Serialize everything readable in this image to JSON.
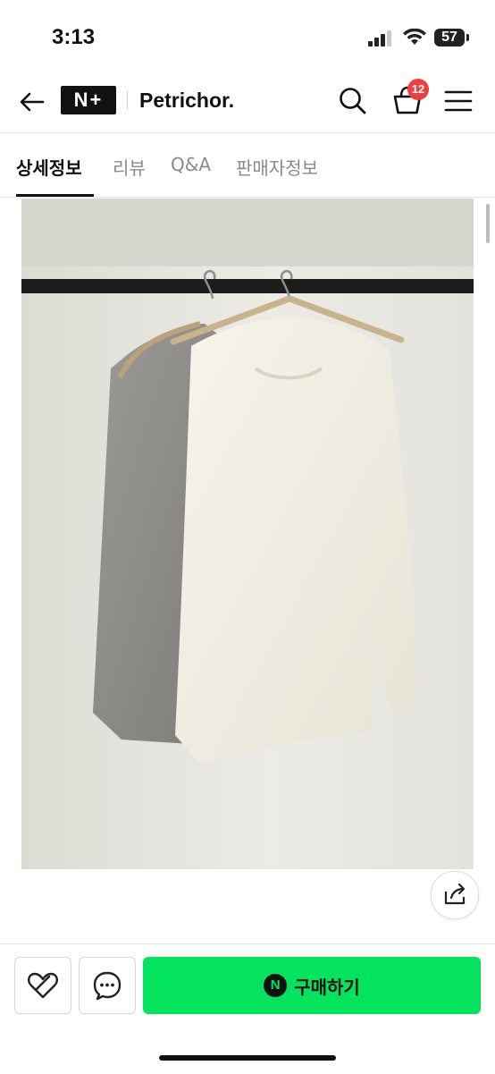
{
  "status_bar": {
    "time": "3:13",
    "battery": "57"
  },
  "header": {
    "logo": "N+",
    "store_name": "Petrichor.",
    "cart_count": "12"
  },
  "tabs": [
    {
      "label": "상세정보",
      "active": true
    },
    {
      "label": "리뷰",
      "active": false
    },
    {
      "label": "Q&A",
      "active": false
    },
    {
      "label": "판매자정보",
      "active": false
    }
  ],
  "bottom_bar": {
    "buy_label": "구매하기",
    "buy_icon_letter": "N"
  },
  "colors": {
    "buy_button": "#03e35d",
    "badge": "#f0403e",
    "active_tab": "#111111",
    "inactive_tab": "#8a8a8a"
  },
  "icons": [
    "back-arrow-icon",
    "search-icon",
    "cart-icon",
    "menu-icon",
    "share-icon",
    "heart-icon",
    "chat-icon"
  ]
}
